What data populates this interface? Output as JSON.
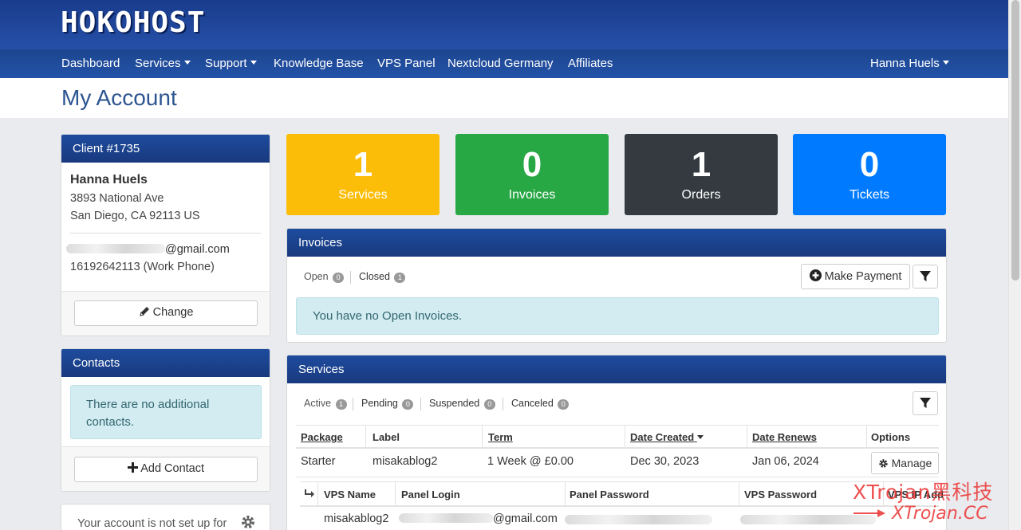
{
  "brand": {
    "logo": "HOKOHOST"
  },
  "nav": {
    "items": [
      {
        "label": "Dashboard"
      },
      {
        "label": "Services"
      },
      {
        "label": "Support"
      },
      {
        "label": "Knowledge Base"
      },
      {
        "label": "VPS Panel"
      },
      {
        "label": "Nextcloud Germany"
      },
      {
        "label": "Affiliates"
      }
    ],
    "user": "Hanna Huels"
  },
  "page": {
    "title": "My Account"
  },
  "client": {
    "header": "Client #1735",
    "name": "Hanna Huels",
    "address1": "3893 National Ave",
    "address2": "San Diego, CA 92113 US",
    "email_suffix": "@gmail.com",
    "phone": "16192642113 (Work Phone)",
    "change_label": "Change"
  },
  "contacts": {
    "header": "Contacts",
    "empty_message": "There are no additional contacts.",
    "add_label": "Add Contact"
  },
  "notice": {
    "text": "Your account is not set up for"
  },
  "tiles": [
    {
      "value": "1",
      "label": "Services",
      "color": "#fbbd08"
    },
    {
      "value": "0",
      "label": "Invoices",
      "color": "#28a745"
    },
    {
      "value": "1",
      "label": "Orders",
      "color": "#343a40"
    },
    {
      "value": "0",
      "label": "Tickets",
      "color": "#007bff"
    }
  ],
  "invoices": {
    "header": "Invoices",
    "filters": [
      {
        "label": "Open",
        "count": "0"
      },
      {
        "label": "Closed",
        "count": "1"
      }
    ],
    "make_payment_label": "Make Payment",
    "empty_message": "You have no Open Invoices."
  },
  "services": {
    "header": "Services",
    "filters": [
      {
        "label": "Active",
        "count": "1"
      },
      {
        "label": "Pending",
        "count": "0"
      },
      {
        "label": "Suspended",
        "count": "0"
      },
      {
        "label": "Canceled",
        "count": "0"
      }
    ],
    "columns": [
      "Package",
      "Label",
      "Term",
      "Date Created",
      "Date Renews",
      "Options"
    ],
    "rows": [
      {
        "package": "Starter",
        "label": "misakablog2",
        "term": "1 Week @ £0.00",
        "date_created": "Dec 30, 2023",
        "date_renews": "Jan 06, 2024",
        "manage_label": "Manage"
      }
    ],
    "sub_columns": [
      "VPS Name",
      "Panel Login",
      "Panel Password",
      "VPS Password",
      "VPS IP Add"
    ],
    "sub_rows": [
      {
        "vps_name": "misakablog2",
        "panel_login_suffix": "@gmail.com"
      }
    ]
  },
  "watermark": {
    "line1": "XTrojan黑科技",
    "line2": "XTrojan.CC"
  },
  "colors": {
    "brand_blue": "#1e4c9e",
    "title_blue": "#2d5591"
  }
}
